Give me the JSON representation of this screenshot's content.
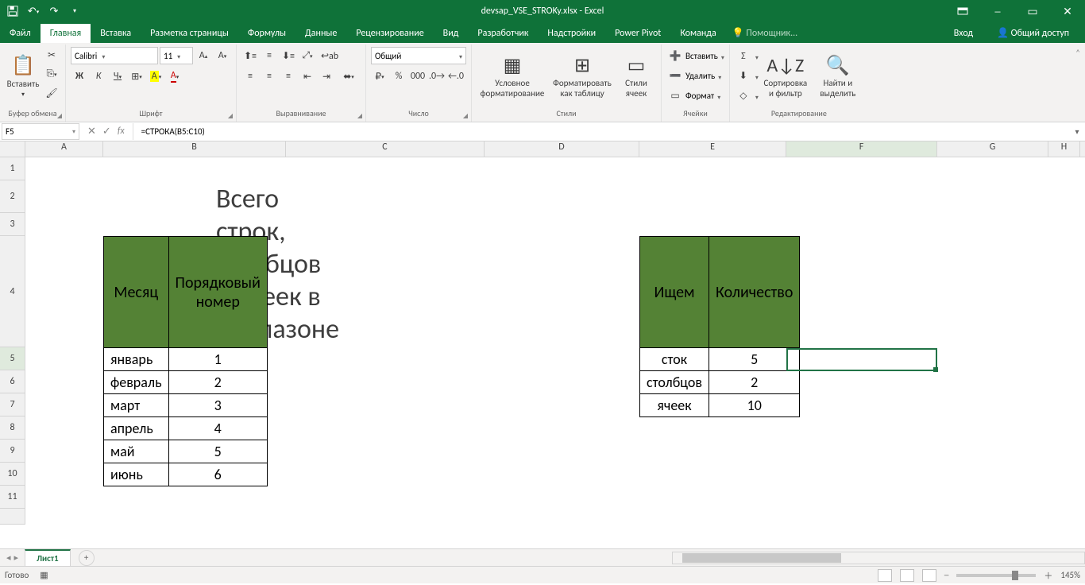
{
  "app": {
    "title": "devsap_VSE_STROKy.xlsx - Excel"
  },
  "win": {
    "login": "Вход",
    "share": "Общий доступ"
  },
  "tabs": {
    "file": "Файл",
    "home": "Главная",
    "insert": "Вставка",
    "layout": "Разметка страницы",
    "formulas": "Формулы",
    "data": "Данные",
    "review": "Рецензирование",
    "view": "Вид",
    "developer": "Разработчик",
    "addins": "Надстройки",
    "powerpivot": "Power Pivot",
    "team": "Команда",
    "help": "Помощник..."
  },
  "ribbon": {
    "paste": "Вставить",
    "clipboard": "Буфер обмена",
    "font": "Шрифт",
    "font_name": "Calibri",
    "font_size": "11",
    "alignment": "Выравнивание",
    "number": "Число",
    "number_format": "Общий",
    "styles": "Стили",
    "cond_fmt": "Условное\nформатирование",
    "fmt_table": "Форматировать\nкак таблицу",
    "cell_styles": "Стили\nячеек",
    "cells": "Ячейки",
    "insert_cells": "Вставить",
    "delete_cells": "Удалить",
    "format_cells": "Формат",
    "editing": "Редактирование",
    "sort_filter": "Сортировка\nи фильтр",
    "find_select": "Найти и\nвыделить"
  },
  "namebox": "F5",
  "formula": "=СТРОКА(B5:C10)",
  "sheet": {
    "title": "Всего строк, столбцов и ячеек в диапазоне",
    "t1": {
      "h1": "Месяц",
      "h2": "Порядковый номер",
      "rows": [
        {
          "m": "январь",
          "n": "1"
        },
        {
          "m": "февраль",
          "n": "2"
        },
        {
          "m": "март",
          "n": "3"
        },
        {
          "m": "апрель",
          "n": "4"
        },
        {
          "m": "май",
          "n": "5"
        },
        {
          "m": "июнь",
          "n": "6"
        }
      ]
    },
    "t2": {
      "h1": "Ищем",
      "h2": "Количество",
      "rows": [
        {
          "k": "сток",
          "v": "5"
        },
        {
          "k": "столбцов",
          "v": "2"
        },
        {
          "k": "ячеек",
          "v": "10"
        }
      ]
    }
  },
  "tabs_bottom": {
    "sheet1": "Лист1"
  },
  "status": {
    "ready": "Готово",
    "zoom": "145%"
  },
  "cols": {
    "A": "A",
    "B": "B",
    "C": "C",
    "D": "D",
    "E": "E",
    "F": "F",
    "G": "G",
    "H": "H"
  }
}
